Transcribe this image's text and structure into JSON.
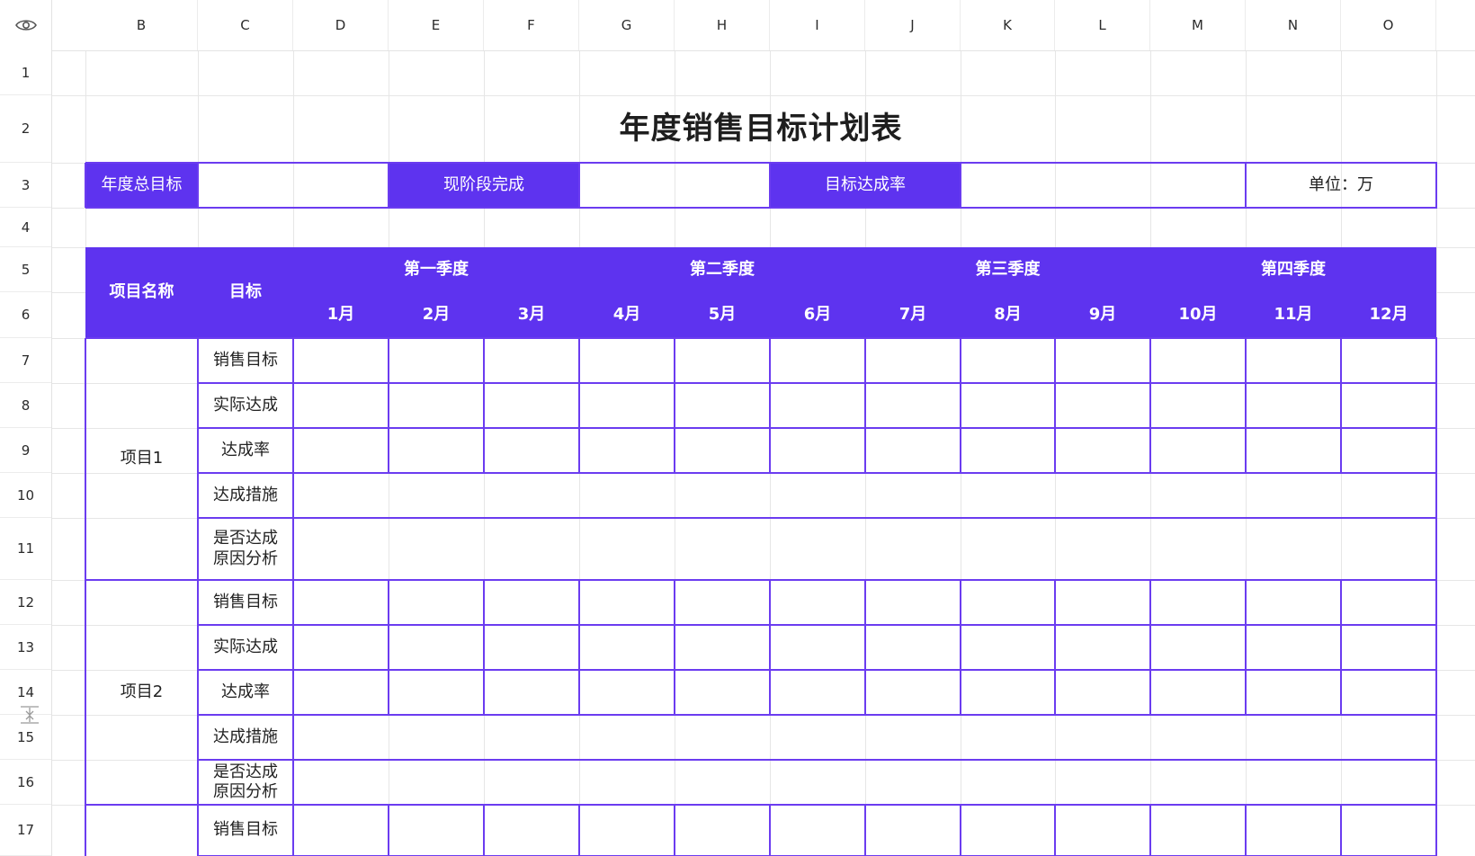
{
  "columns": [
    "B",
    "C",
    "D",
    "E",
    "F",
    "G",
    "H",
    "I",
    "J",
    "K",
    "L",
    "M",
    "N",
    "O"
  ],
  "rows": [
    "1",
    "2",
    "3",
    "4",
    "5",
    "6",
    "7",
    "8",
    "9",
    "10",
    "11",
    "12",
    "13",
    "14",
    "15",
    "16",
    "17"
  ],
  "sheet": {
    "title": "年度销售目标计划表",
    "summary": {
      "annual_target_label": "年度总目标",
      "current_label": "现阶段完成",
      "rate_label": "目标达成率",
      "unit_label": "单位：万"
    },
    "header": {
      "project_name": "项目名称",
      "target": "目标",
      "quarters": [
        "第一季度",
        "第二季度",
        "第三季度",
        "第四季度"
      ],
      "months": [
        "1月",
        "2月",
        "3月",
        "4月",
        "5月",
        "6月",
        "7月",
        "8月",
        "9月",
        "10月",
        "11月",
        "12月"
      ]
    },
    "metrics": [
      "销售目标",
      "实际达成",
      "达成率",
      "达成措施",
      "是否达成\n原因分析"
    ],
    "projects": [
      "项目1",
      "项目2"
    ]
  },
  "colors": {
    "accent": "#5e33ef",
    "border": "#6b3cf0",
    "grid": "#e6e6e6"
  },
  "icons": {
    "corner": "eye-icon",
    "resize": "row-resize-icon"
  }
}
